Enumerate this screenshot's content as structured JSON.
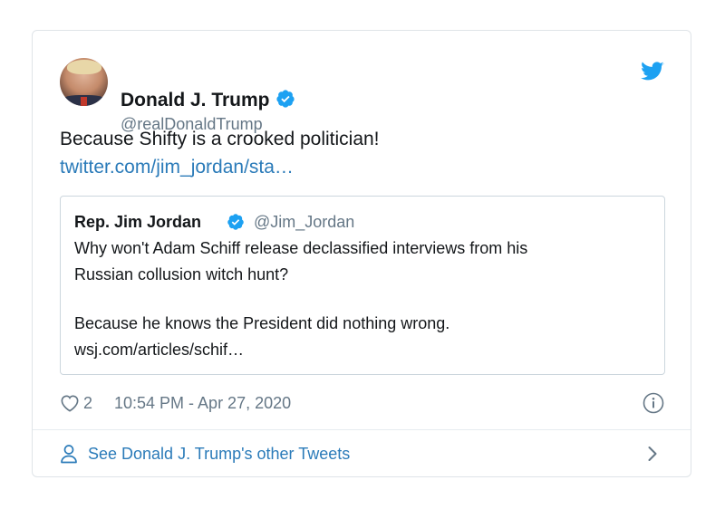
{
  "author": {
    "name": "Donald J. Trump",
    "handle": "@realDonaldTrump"
  },
  "tweet": {
    "text": "Because Shifty is a crooked politician!",
    "link": "twitter.com/jim_jordan/sta…"
  },
  "quoted_tweet": {
    "name": "Rep. Jim Jordan",
    "handle": "@Jim_Jordan",
    "line1": "Why won't Adam Schiff release declassified interviews from his",
    "line2": "Russian collusion witch hunt?",
    "line3": "Because he knows the President did nothing wrong.",
    "link": "wsj.com/articles/schif…"
  },
  "meta": {
    "like_count": "2",
    "timestamp": "10:54 PM - Apr 27, 2020"
  },
  "footer": {
    "label": "See Donald J. Trump's other Tweets"
  },
  "icons": {
    "verified": "verified-badge-icon",
    "brand": "twitter-bird-icon",
    "like": "heart-icon",
    "info": "info-icon",
    "profile": "person-icon",
    "more": "chevron-right-icon"
  },
  "colors": {
    "accent": "#1da1f2",
    "link": "#2b7bb9",
    "muted": "#657786",
    "border": "#ccd6dd"
  }
}
